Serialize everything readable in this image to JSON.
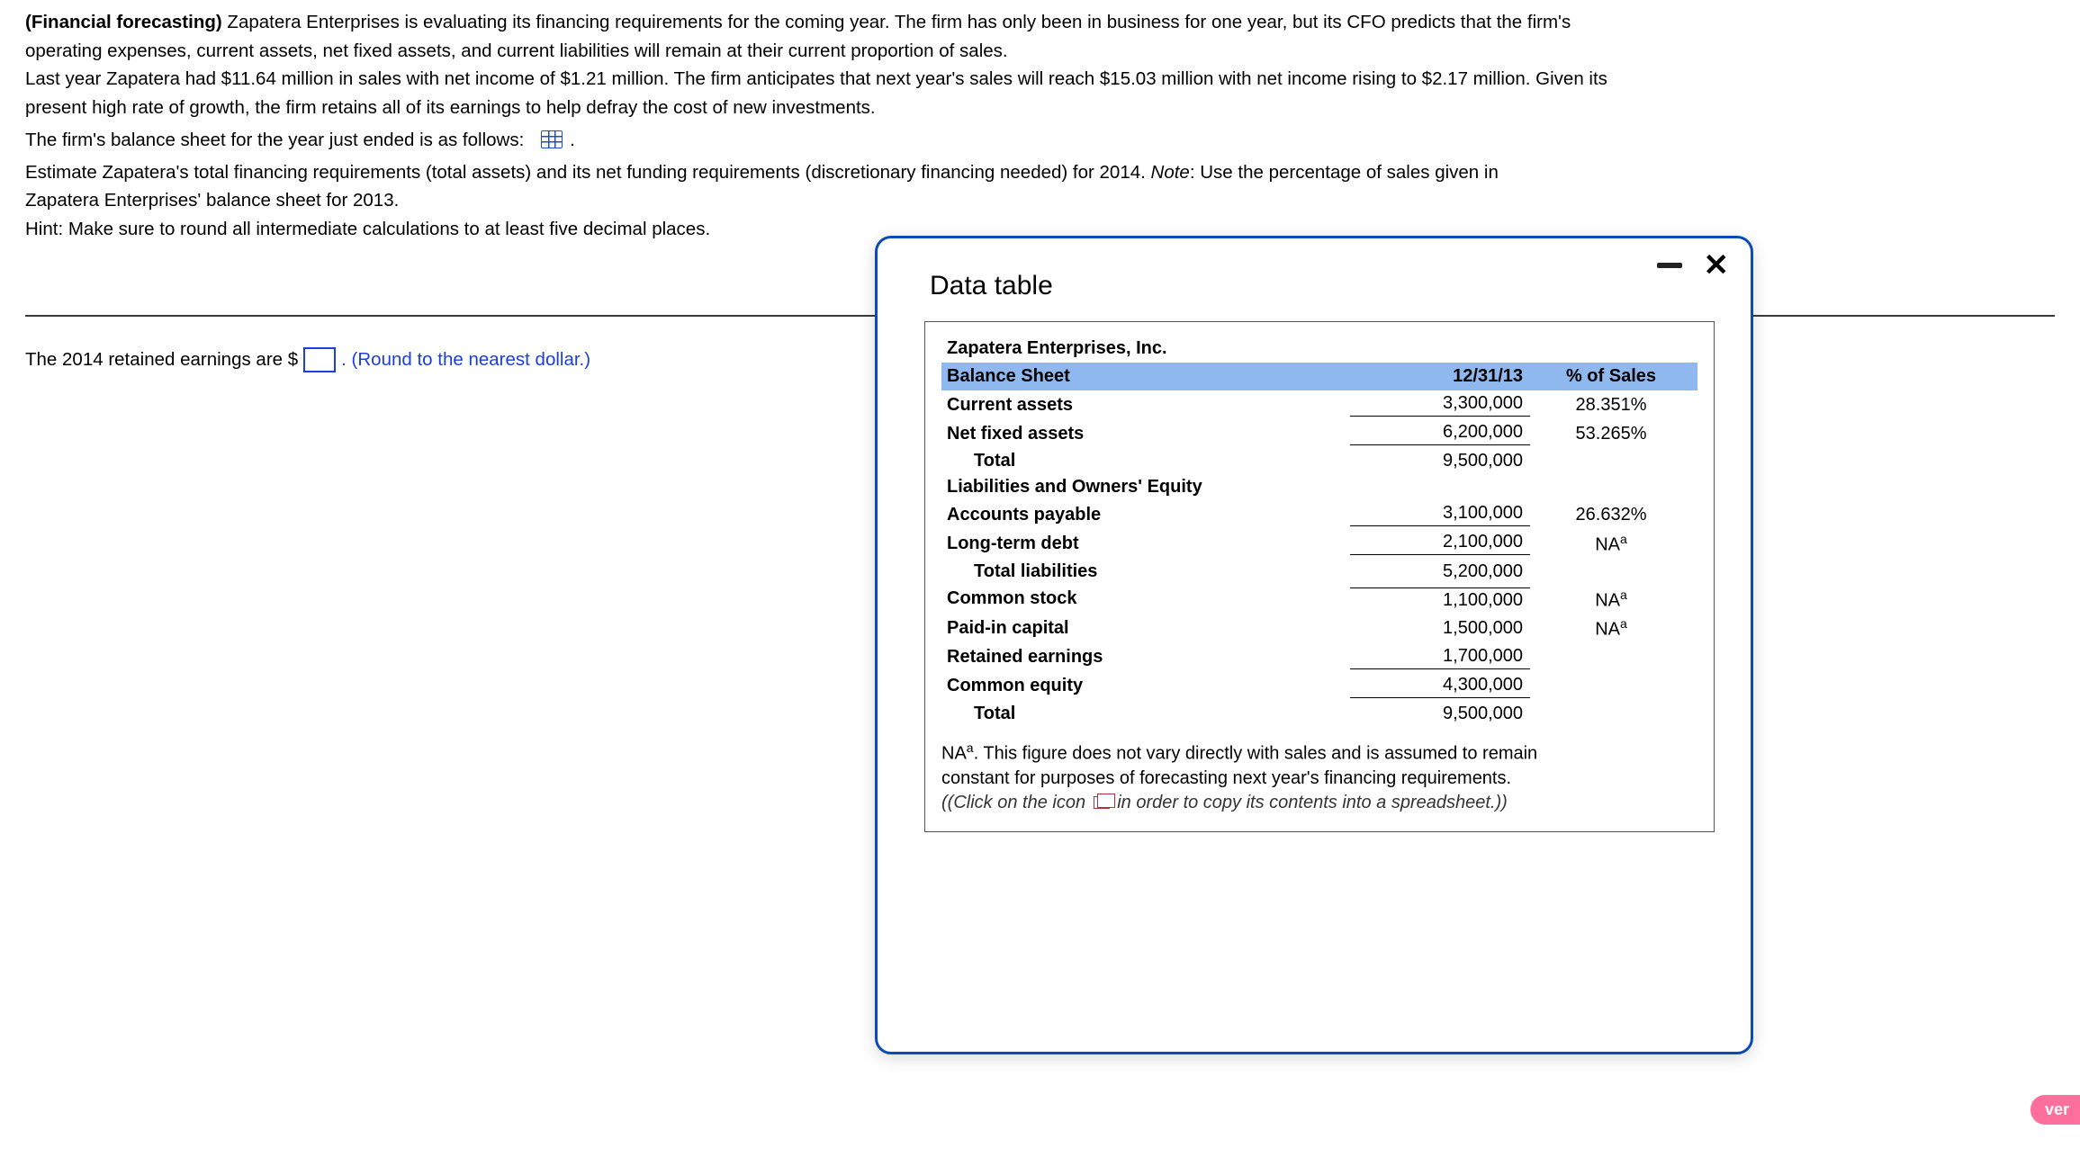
{
  "problem": {
    "tag": "(Financial forecasting)",
    "s1a": "Zapatera Enterprises is evaluating its financing requirements for the coming year.  The firm has only been in business for one year, but its CFO predicts that the firm's",
    "s1b": "operating expenses, current assets, net fixed assets, and current liabilities will remain at their current proportion of sales.",
    "s2a": "Last year Zapatera had $11.64 million in sales with net income of $1.21 million.  The firm anticipates that next year's sales will reach $15.03 million with net income rising to $2.17 million.  Given its",
    "s2b": "present high rate of growth, the firm retains all of its earnings to help defray the cost of new investments.",
    "s3": "The firm's balance sheet for the year just ended is as follows:",
    "period": ".",
    "s4a": "Estimate Zapatera's total financing requirements (total assets) and its net funding requirements (discretionary financing needed) for 2014.  ",
    "s4note": "Note",
    "s4b": ":  Use the percentage of sales given in",
    "s4c": "Zapatera Enterprises' balance sheet for 2013.",
    "hint": "Hint: Make sure to round all intermediate calculations to at least five decimal places."
  },
  "answer": {
    "lead": "The 2014 retained earnings are $",
    "tail": ".  (Round to the nearest dollar.)"
  },
  "modal": {
    "title": "Data table",
    "company": "Zapatera Enterprises, Inc.",
    "hdr": {
      "c1": "Balance Sheet",
      "c2": "12/31/13",
      "c3": "% of Sales"
    },
    "rows": [
      {
        "c1": "Current assets",
        "c2": "3,300,000",
        "c3": "28.351%",
        "cls": "bold under"
      },
      {
        "c1": "Net fixed assets",
        "c2": "6,200,000",
        "c3": "53.265%",
        "cls": "bold under"
      },
      {
        "c1": "Total",
        "c2": "9,500,000",
        "c3": "",
        "cls": "indent1"
      },
      {
        "c1": "Liabilities and Owners' Equity",
        "c2": "",
        "c3": "",
        "cls": "boldall"
      },
      {
        "c1": "Accounts payable",
        "c2": "3,100,000",
        "c3": "26.632%",
        "cls": "bold under"
      },
      {
        "c1": "Long-term debt",
        "c2": "2,100,000",
        "c3": "NA",
        "cls": "bold under",
        "na": true
      },
      {
        "c1": "Total liabilities",
        "c2": "5,200,000",
        "c3": "",
        "cls": "indent1"
      },
      {
        "c1": "Common stock",
        "c2": "1,100,000",
        "c3": "NA",
        "cls": "bold topbar",
        "na": true
      },
      {
        "c1": "Paid-in capital",
        "c2": "1,500,000",
        "c3": "NA",
        "cls": "bold",
        "na": true
      },
      {
        "c1": "Retained earnings",
        "c2": "1,700,000",
        "c3": "",
        "cls": "bold under"
      },
      {
        "c1": "Common equity",
        "c2": "4,300,000",
        "c3": "",
        "cls": "bold under"
      },
      {
        "c1": "Total",
        "c2": "9,500,000",
        "c3": "",
        "cls": "indent1"
      }
    ],
    "footnote_na": "NA",
    "footnote_sup": "a",
    "footnote_text1": ".  This figure does not vary directly with sales and is assumed to remain",
    "footnote_text2": "constant for purposes of forecasting next year's financing requirements.",
    "footnote_hint_a": "(Click on the icon",
    "footnote_hint_b": "in order to copy its contents into a spreadsheet.)"
  },
  "ver": "ver"
}
